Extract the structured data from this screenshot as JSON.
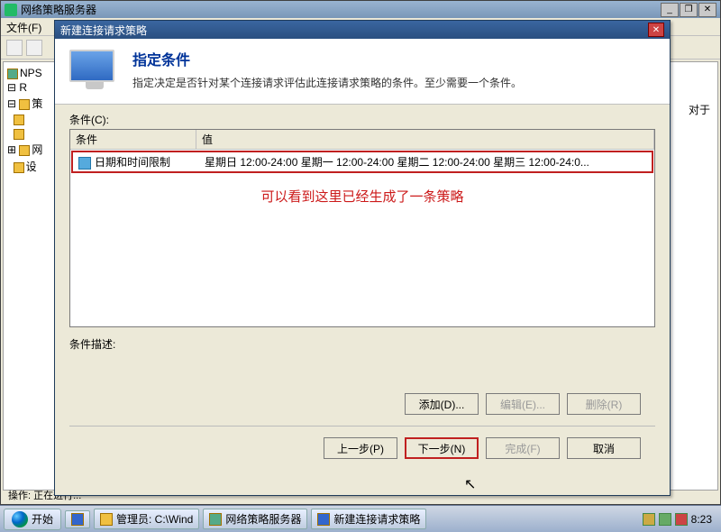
{
  "parent": {
    "title": "网络策略服务器",
    "menu": {
      "file": "文件(F)"
    },
    "tree": {
      "root": "NPS",
      "r": "R",
      "folder1": "策",
      "folder2": "网",
      "folder3": "设"
    },
    "right_label": "对于",
    "status": "操作: 正在进行..."
  },
  "dialog": {
    "title": "新建连接请求策略",
    "heading": "指定条件",
    "subheading": "指定决定是否针对某个连接请求评估此连接请求策略的条件。至少需要一个条件。",
    "cond_label": "条件(C):",
    "columns": {
      "condition": "条件",
      "value": "值"
    },
    "row": {
      "condition": "日期和时间限制",
      "value": "星期日 12:00-24:00 星期一 12:00-24:00 星期二 12:00-24:00 星期三 12:00-24:0..."
    },
    "annotation": "可以看到这里已经生成了一条策略",
    "desc_label": "条件描述:",
    "buttons": {
      "add": "添加(D)...",
      "edit": "编辑(E)...",
      "remove": "删除(R)",
      "back": "上一步(P)",
      "next": "下一步(N)",
      "finish": "完成(F)",
      "cancel": "取消"
    }
  },
  "taskbar": {
    "start": "开始",
    "btn1": "管理员: C:\\Wind",
    "btn2": "网络策略服务器",
    "btn3": "新建连接请求策略",
    "clock": "8:23"
  }
}
